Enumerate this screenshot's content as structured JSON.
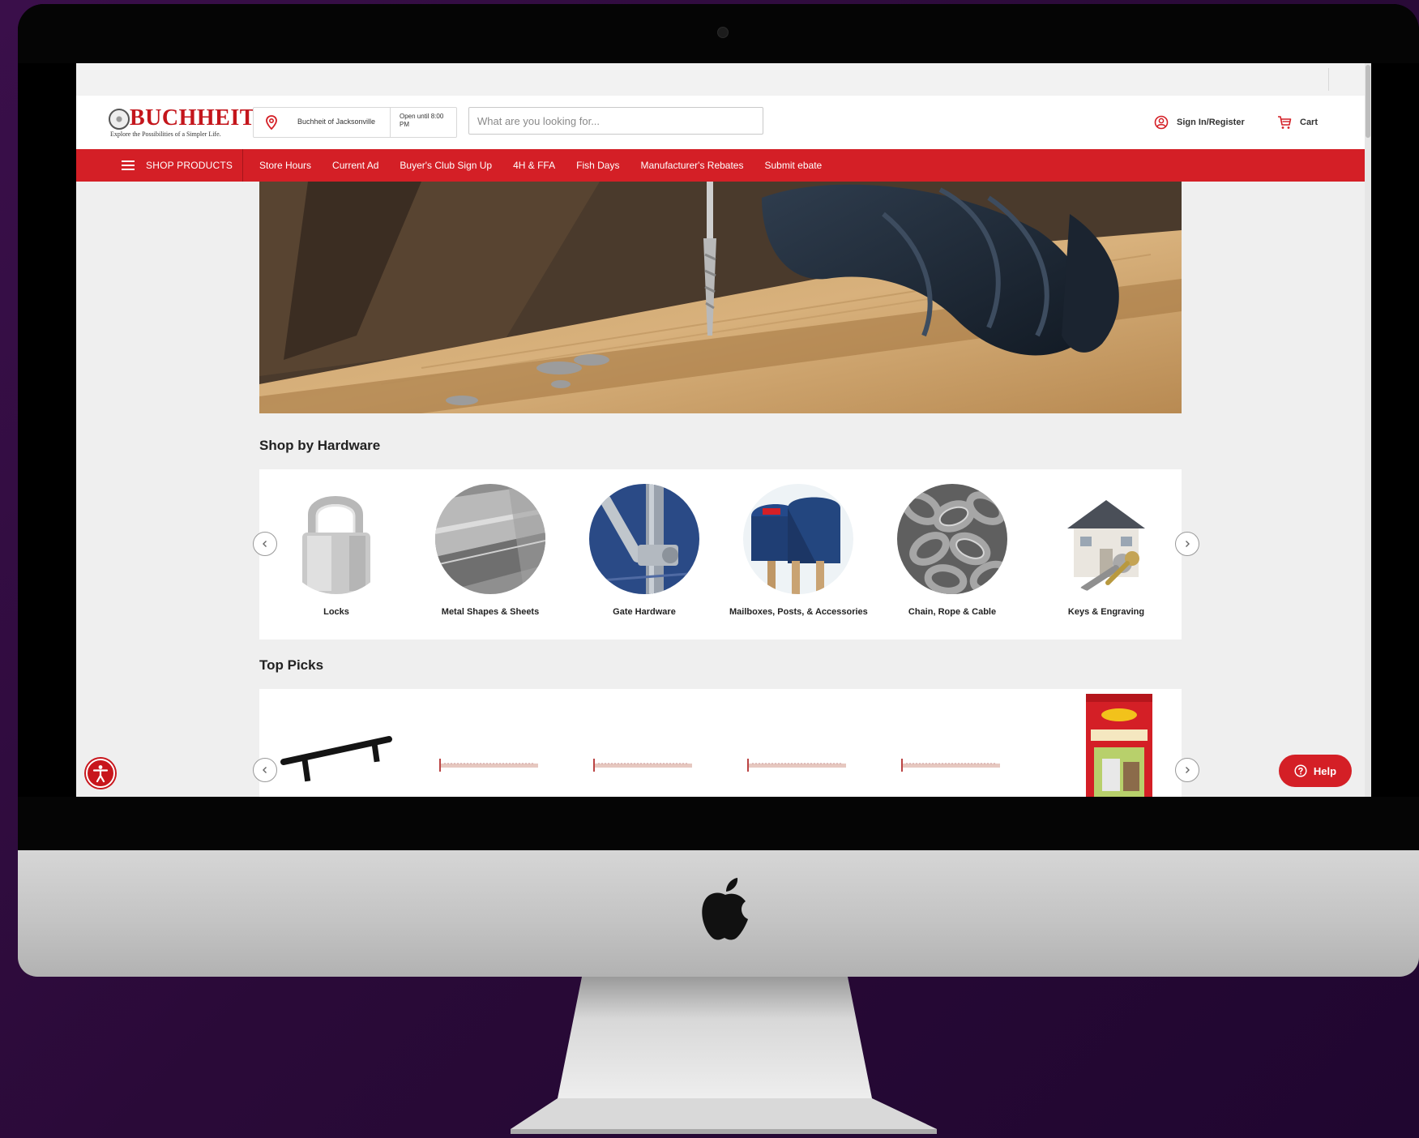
{
  "header": {
    "logo_text": "BUCHHEIT",
    "logo_tagline": "Explore the Possibilities of a Simpler Life.",
    "store_name": "Buchheit of Jacksonville",
    "store_hours": "Open until 8:00 PM",
    "search_placeholder": "What are you looking for...",
    "signin_label": "Sign In/Register",
    "cart_label": "Cart"
  },
  "nav": {
    "shop_label": "SHOP PRODUCTS",
    "links": [
      "Store Hours",
      "Current Ad",
      "Buyer's Club Sign Up",
      "4H & FFA",
      "Fish Days",
      "Manufacturer's Rebates",
      "Submit ebate"
    ]
  },
  "shop_by": {
    "title": "Shop by Hardware",
    "categories": [
      {
        "label": "Locks",
        "icon": "padlock"
      },
      {
        "label": "Metal Shapes & Sheets",
        "icon": "metal-sheets"
      },
      {
        "label": "Gate Hardware",
        "icon": "gate-latch"
      },
      {
        "label": "Mailboxes, Posts, & Accessories",
        "icon": "mailbox"
      },
      {
        "label": "Chain, Rope & Cable",
        "icon": "chain"
      },
      {
        "label": "Keys & Engraving",
        "icon": "keys-house"
      }
    ]
  },
  "top_picks": {
    "title": "Top Picks"
  },
  "help": {
    "label": "Help"
  },
  "colors": {
    "brand_red": "#d41f26",
    "background": "#efefef"
  }
}
